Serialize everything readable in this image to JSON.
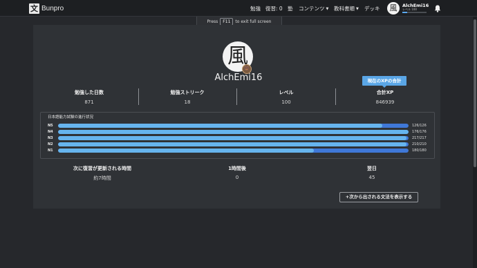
{
  "navbar": {
    "brand_logo": "文",
    "brand_name": "Bunpro",
    "links": [
      {
        "label": "勉強",
        "caret": false
      },
      {
        "label": "復習: 0",
        "caret": false
      },
      {
        "label": "塾",
        "caret": false
      },
      {
        "label": "コンテンツ",
        "caret": true
      },
      {
        "label": "教科書順",
        "caret": true
      },
      {
        "label": "デッキ",
        "caret": false
      }
    ],
    "avatar_char": "風",
    "user_name": "AlchEmi16",
    "user_level": "レベル 100",
    "xp_progress": 0.2,
    "bell_icon": "bell-icon"
  },
  "fullscreen_toast": {
    "before": "Press",
    "key": "F11",
    "after": "to exit full screen"
  },
  "profile": {
    "avatar_char": "風",
    "badge_char": "🐻",
    "username": "AlchEmi16",
    "xp_tooltip": "現在のXPの合計"
  },
  "stats": [
    {
      "label": "勉強した日数",
      "value": "871"
    },
    {
      "label": "勉強ストリーク",
      "value": "18"
    },
    {
      "label": "レベル",
      "value": "100"
    },
    {
      "label": "合計XP",
      "value": "846939"
    }
  ],
  "jlpt": {
    "title": "日本語能力試験の進行状況",
    "rows": [
      {
        "level": "N5",
        "count": "126/126",
        "known": 0.925,
        "total": 1.0
      },
      {
        "level": "N4",
        "count": "176/176",
        "known": 1.0,
        "total": 1.0
      },
      {
        "level": "N3",
        "count": "217/217",
        "known": 0.995,
        "total": 1.0
      },
      {
        "level": "N2",
        "count": "210/210",
        "known": 0.995,
        "total": 1.0
      },
      {
        "level": "N1",
        "count": "180/180",
        "known": 0.73,
        "total": 1.0
      }
    ]
  },
  "reviews": [
    {
      "label": "次に復習が更新される時間",
      "value": "約7時間"
    },
    {
      "label": "1時間後",
      "value": "0"
    },
    {
      "label": "翌日",
      "value": "45"
    }
  ],
  "next_grammar_button": "+次から出される文法を表示する",
  "colors": {
    "accent": "#5aa6e6",
    "bar_known": "#66b4ee",
    "bar_total": "#3f78d8",
    "background": "#26282c",
    "card": "#2f3236"
  }
}
